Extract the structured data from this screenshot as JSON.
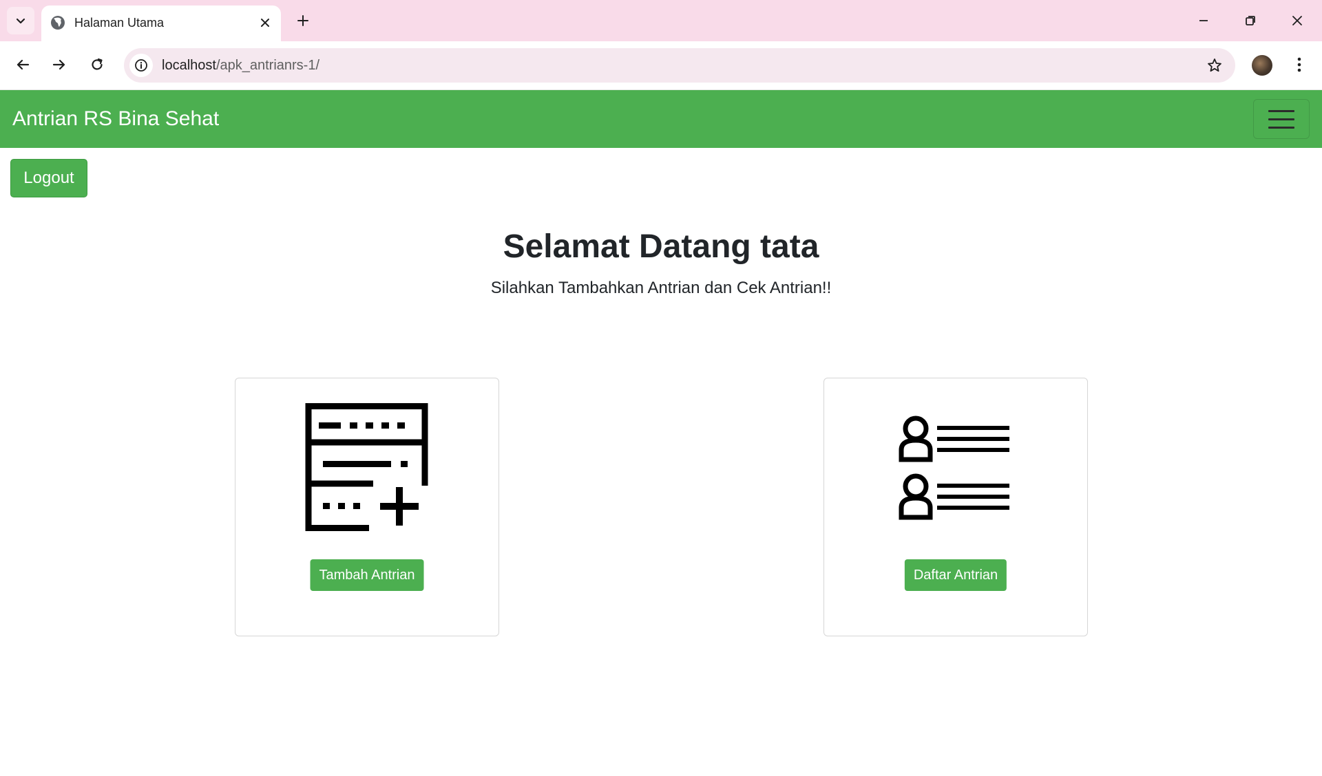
{
  "browser": {
    "tab_title": "Halaman Utama",
    "url_host": "localhost",
    "url_path": "/apk_antrianrs-1/"
  },
  "navbar": {
    "brand": "Antrian RS Bina Sehat"
  },
  "actions": {
    "logout_label": "Logout"
  },
  "hero": {
    "title": "Selamat Datang tata",
    "subtitle": "Silahkan Tambahkan Antrian dan Cek Antrian!!"
  },
  "cards": [
    {
      "icon": "queue-form-add-icon",
      "button_label": "Tambah Antrian"
    },
    {
      "icon": "user-list-icon",
      "button_label": "Daftar Antrian"
    }
  ],
  "colors": {
    "primary": "#4caf50",
    "tabbar": "#f9dbe9",
    "text": "#212529"
  }
}
